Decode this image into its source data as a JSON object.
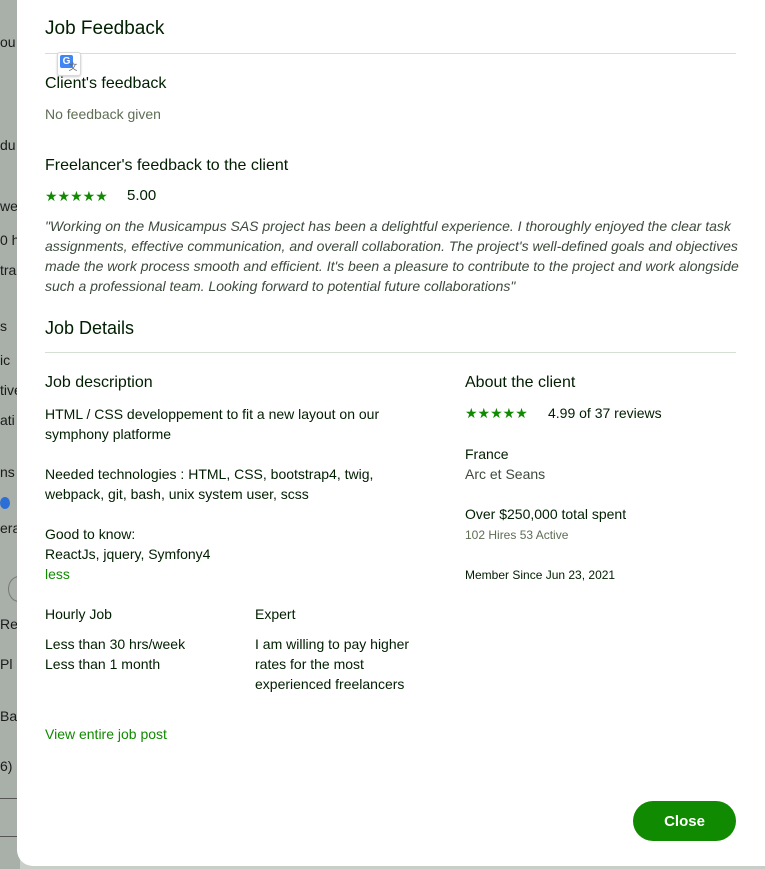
{
  "background_fragments": [
    "ou",
    "du",
    "we",
    "0 h",
    "tra",
    "s",
    "ic",
    "tive",
    "ati",
    "ns",
    "era",
    "Re",
    "Pl",
    "Ba",
    "6)"
  ],
  "modal": {
    "title": "Job Feedback",
    "translate_icon": "google-translate-icon",
    "client_feedback": {
      "heading": "Client's feedback",
      "text": "No feedback given"
    },
    "freelancer_feedback": {
      "heading": "Freelancer's feedback to the client",
      "stars": "★★★★★",
      "rating": "5.00",
      "quote": "\"Working on the Musicampus SAS project has been a delightful experience. I thoroughly enjoyed the clear task assignments, effective communication, and overall collaboration. The project's well-defined goals and objectives made the work process smooth and efficient. It's been a pleasure to contribute to the project and work alongside such a professional team. Looking forward to potential future collaborations\""
    },
    "job_details": {
      "heading": "Job Details",
      "description": {
        "heading": "Job description",
        "para1": "HTML / CSS developpement to fit a new layout on our symphony platforme",
        "para2": "Needed technologies : HTML, CSS, bootstrap4, twig, webpack, git, bash, unix system user, scss",
        "para3_line1": "Good to know:",
        "para3_line2": "ReactJs, jquery, Symfony4",
        "less_link": "less"
      },
      "hourly": {
        "heading": "Hourly Job",
        "line1": "Less than 30 hrs/week",
        "line2": "Less than 1 month"
      },
      "level": {
        "heading": "Expert",
        "text": "I am willing to pay higher rates for the most experienced freelancers"
      },
      "view_link": "View entire job post"
    },
    "about_client": {
      "heading": "About the client",
      "stars": "★★★★★",
      "rating": "4.99 of 37 reviews",
      "country": "France",
      "city": "Arc et Seans",
      "spent": "Over $250,000 total spent",
      "hires": "102 Hires 53 Active",
      "member_since": "Member Since Jun 23, 2021"
    },
    "close_label": "Close"
  },
  "colors": {
    "accent": "#108a00",
    "text": "#001e00",
    "muted": "#5e6d55"
  }
}
